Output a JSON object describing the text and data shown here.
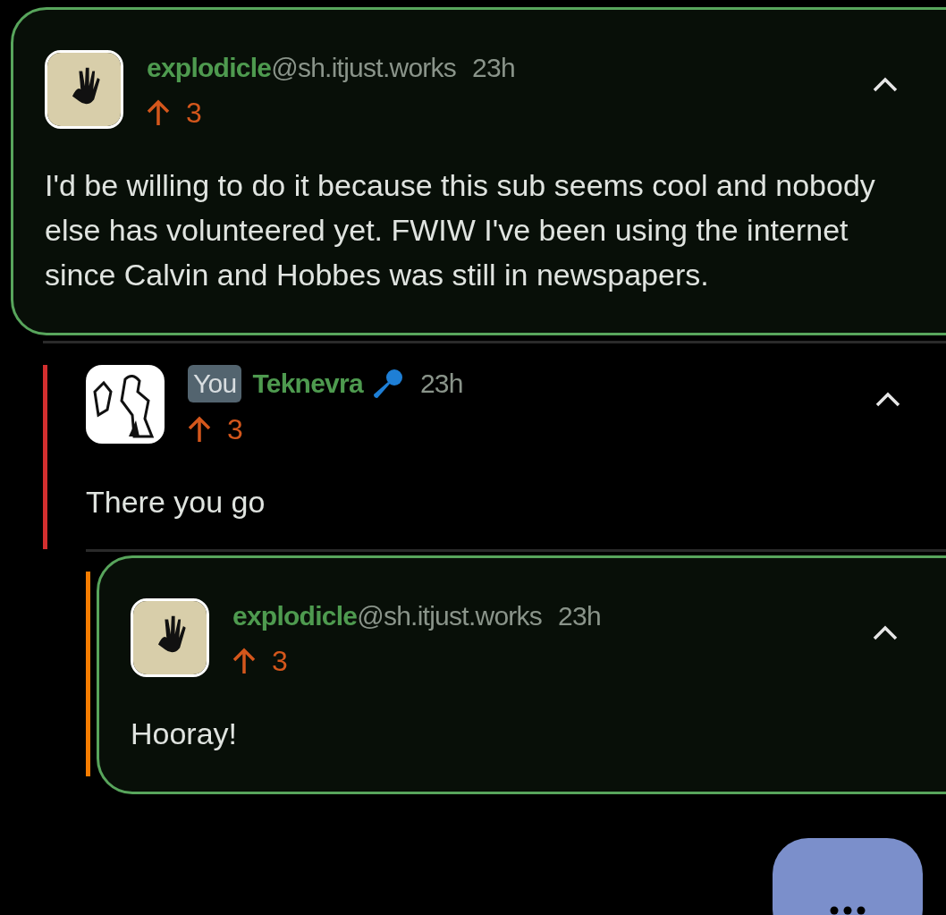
{
  "comments": [
    {
      "author": "explodicle",
      "instance": "@sh.itjust.works",
      "time": "23h",
      "score": "3",
      "body": "I'd be willing to do it because this sub seems cool and nobody else has volunteered yet. FWIW I've been using the internet since Calvin and Hobbes was still in newspapers.",
      "highlighted": true,
      "expanded": true,
      "flair": false
    },
    {
      "badge": "You",
      "author": "Teknevra",
      "time": "23h",
      "score": "3",
      "body": "There you go",
      "highlighted": false,
      "expanded": true,
      "flair": true,
      "color": "#d32f2f"
    },
    {
      "author": "explodicle",
      "instance": "@sh.itjust.works",
      "time": "23h",
      "score": "3",
      "body": "Hooray!",
      "highlighted": true,
      "expanded": true,
      "flair": false,
      "color": "#f57c00"
    }
  ]
}
